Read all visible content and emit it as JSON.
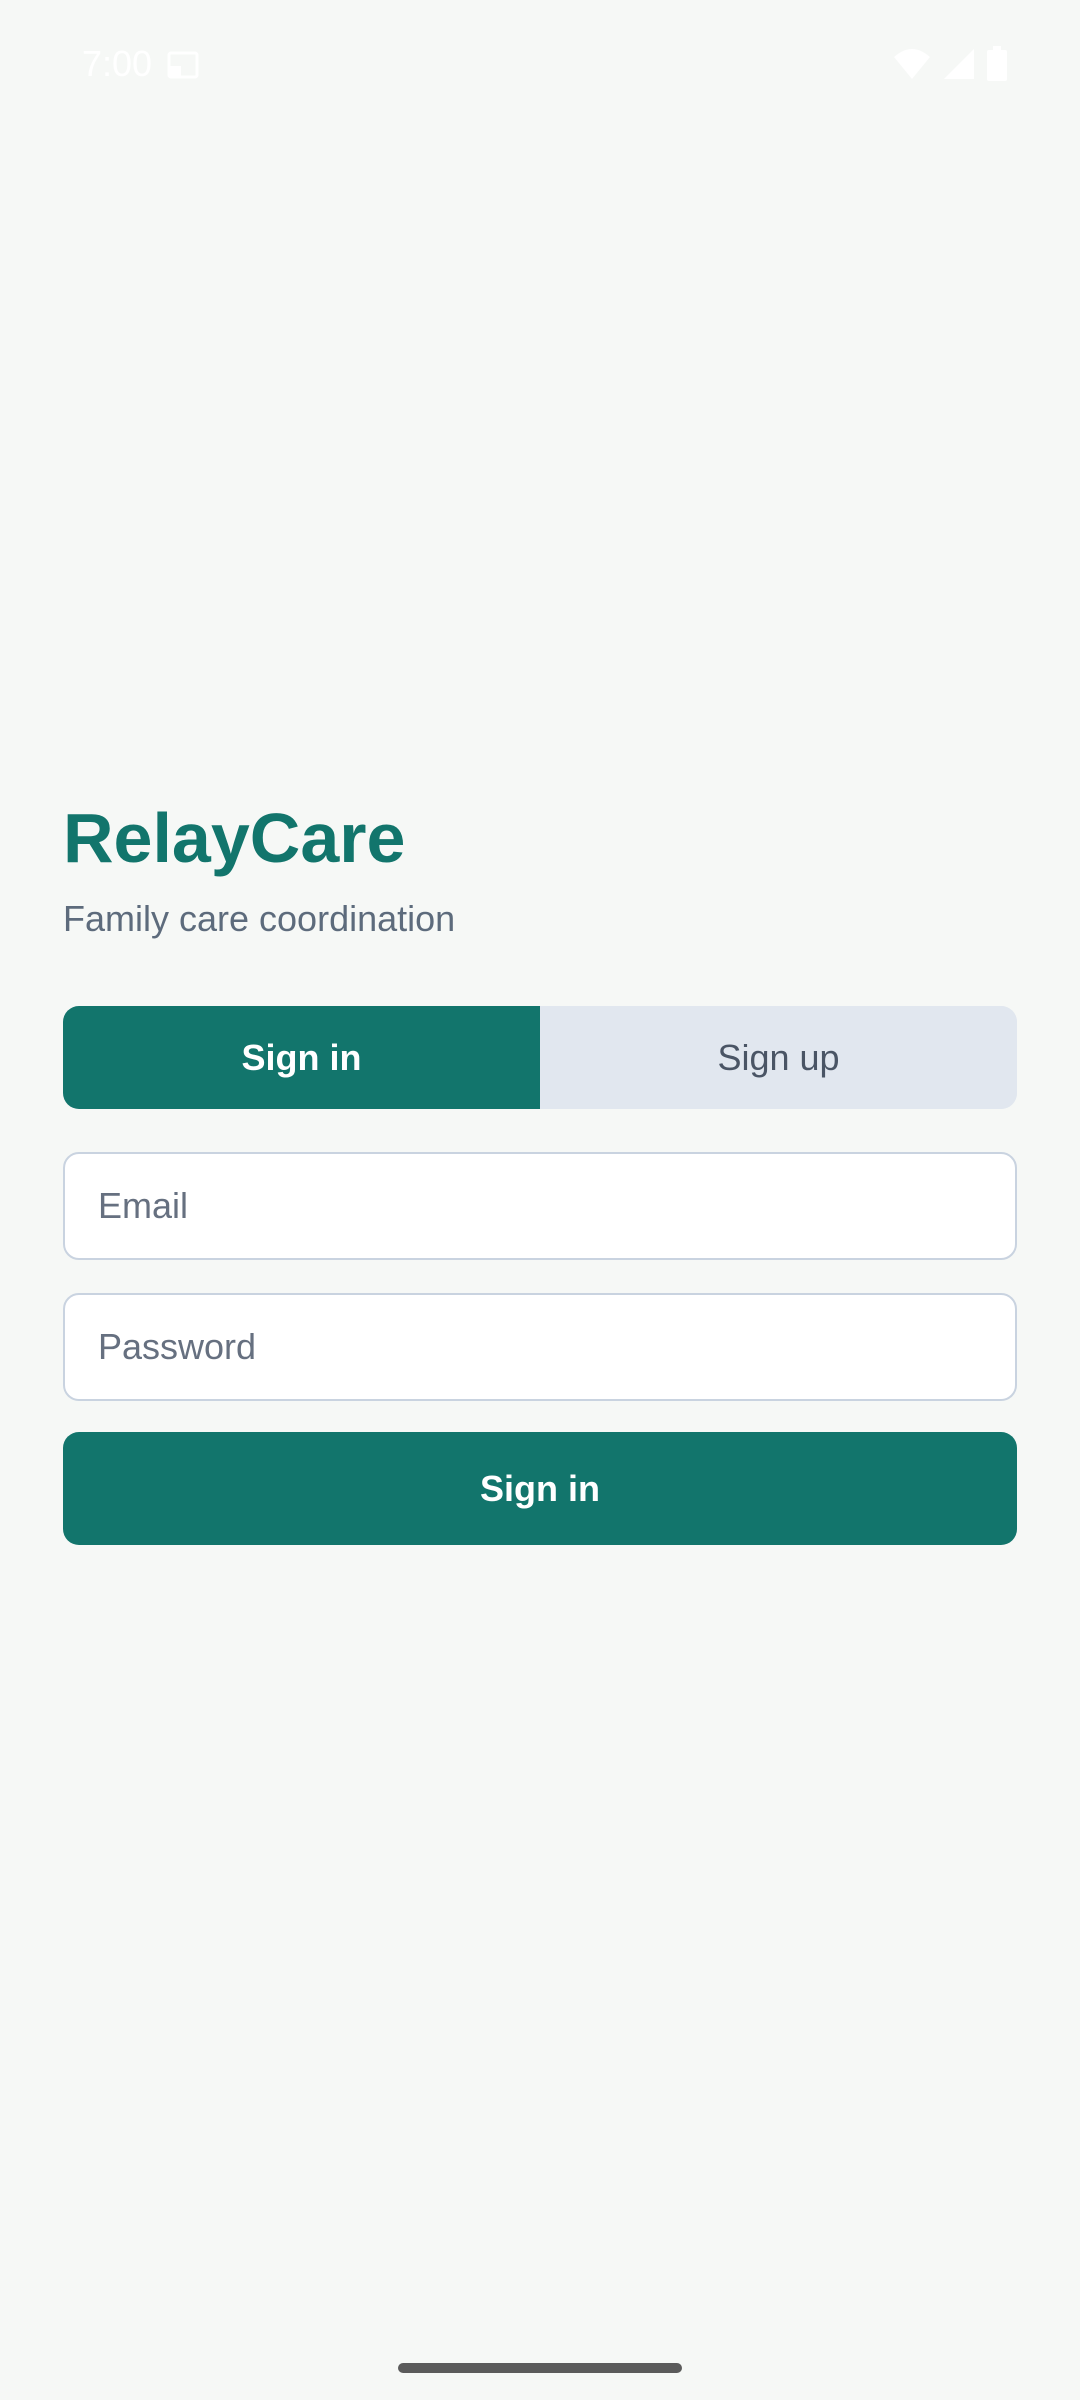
{
  "status_bar": {
    "time": "7:00",
    "icons": [
      "screen-record-icon",
      "wifi-icon",
      "signal-icon",
      "battery-icon"
    ]
  },
  "app": {
    "title": "RelayCare",
    "subtitle": "Family care coordination"
  },
  "tabs": [
    {
      "label": "Sign in",
      "selected": true
    },
    {
      "label": "Sign up",
      "selected": false
    }
  ],
  "form": {
    "email_placeholder": "Email",
    "email_value": "",
    "password_placeholder": "Password",
    "password_value": "",
    "submit_label": "Sign in"
  },
  "colors": {
    "brand": "#12756c",
    "background": "#f6f8f6",
    "tab_inactive": "#e1e7ef",
    "subtitle_text": "#5d6b7c",
    "field_border": "#c9d3e0"
  }
}
